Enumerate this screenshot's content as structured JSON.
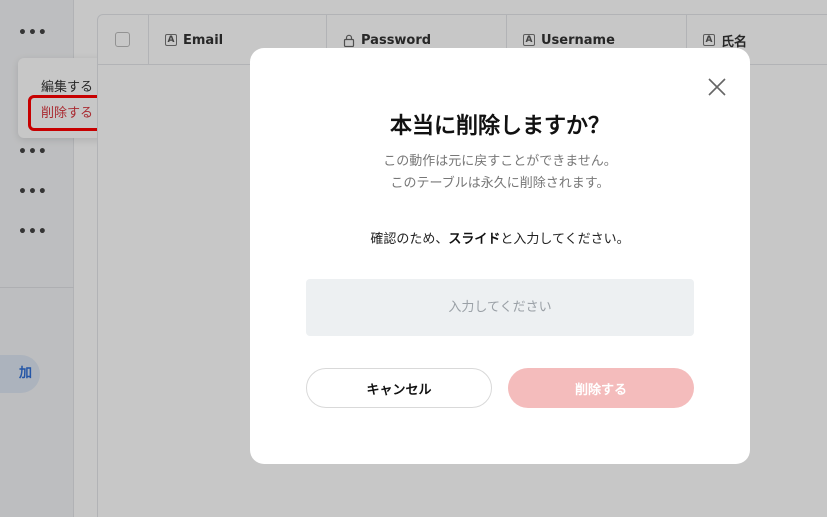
{
  "sidebar": {
    "dots": [
      "•••",
      "•••",
      "•••",
      "•••",
      "•••"
    ],
    "add_button_label": "加"
  },
  "context_menu": {
    "edit_label": "編集する",
    "delete_label": "削除する"
  },
  "table": {
    "columns": [
      {
        "label": "Email",
        "icon": "text-type-icon"
      },
      {
        "label": "Password",
        "icon": "lock-icon"
      },
      {
        "label": "Username",
        "icon": "text-type-icon"
      },
      {
        "label": "氏名",
        "icon": "text-type-icon"
      }
    ],
    "type_glyph": "A"
  },
  "modal": {
    "title": "本当に削除しますか？",
    "description_line1": "この動作は元に戻すことができません。",
    "description_line2": "このテーブルは永久に削除されます。",
    "confirm_prefix": "確認のため、",
    "confirm_keyword": "スライド",
    "confirm_suffix": "と入力してください。",
    "input_value": "",
    "input_placeholder": "入力してください",
    "cancel_label": "キャンセル",
    "delete_label": "削除する"
  },
  "colors": {
    "overlay": "rgba(0,0,0,0.22)",
    "delete_button": "#f4bcbc",
    "delete_text": "#d9373f",
    "highlight": "#ff0000",
    "accent": "#2f6fd6"
  }
}
